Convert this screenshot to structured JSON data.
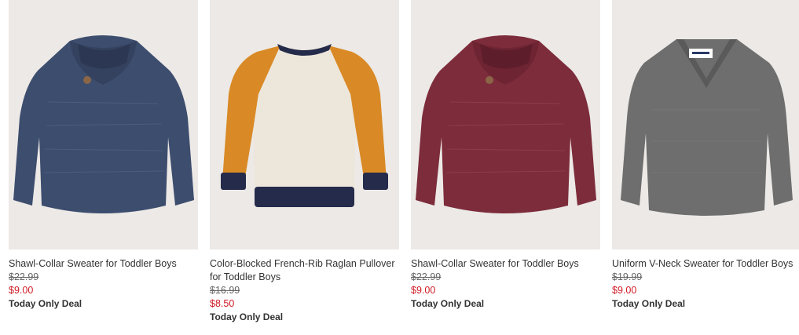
{
  "products": [
    {
      "name": "Shawl-Collar Sweater for Toddler Boys",
      "old_price": "$22.99",
      "sale_price": "$9.00",
      "badge": "Today Only Deal",
      "image": "navy-shawl-collar-sweater",
      "color": "#3d4d6e"
    },
    {
      "name": "Color-Blocked French-Rib Raglan Pullover for Toddler Boys",
      "old_price": "$16.99",
      "sale_price": "$8.50",
      "badge": "Today Only Deal",
      "image": "orange-cream-raglan-pullover",
      "color": "#d98a26"
    },
    {
      "name": "Shawl-Collar Sweater for Toddler Boys",
      "old_price": "$22.99",
      "sale_price": "$9.00",
      "badge": "Today Only Deal",
      "image": "burgundy-shawl-collar-sweater",
      "color": "#7d2c3b"
    },
    {
      "name": "Uniform V-Neck Sweater for Toddler Boys",
      "old_price": "$19.99",
      "sale_price": "$9.00",
      "badge": "Today Only Deal",
      "image": "gray-v-neck-sweater",
      "color": "#6e6e6e"
    }
  ]
}
